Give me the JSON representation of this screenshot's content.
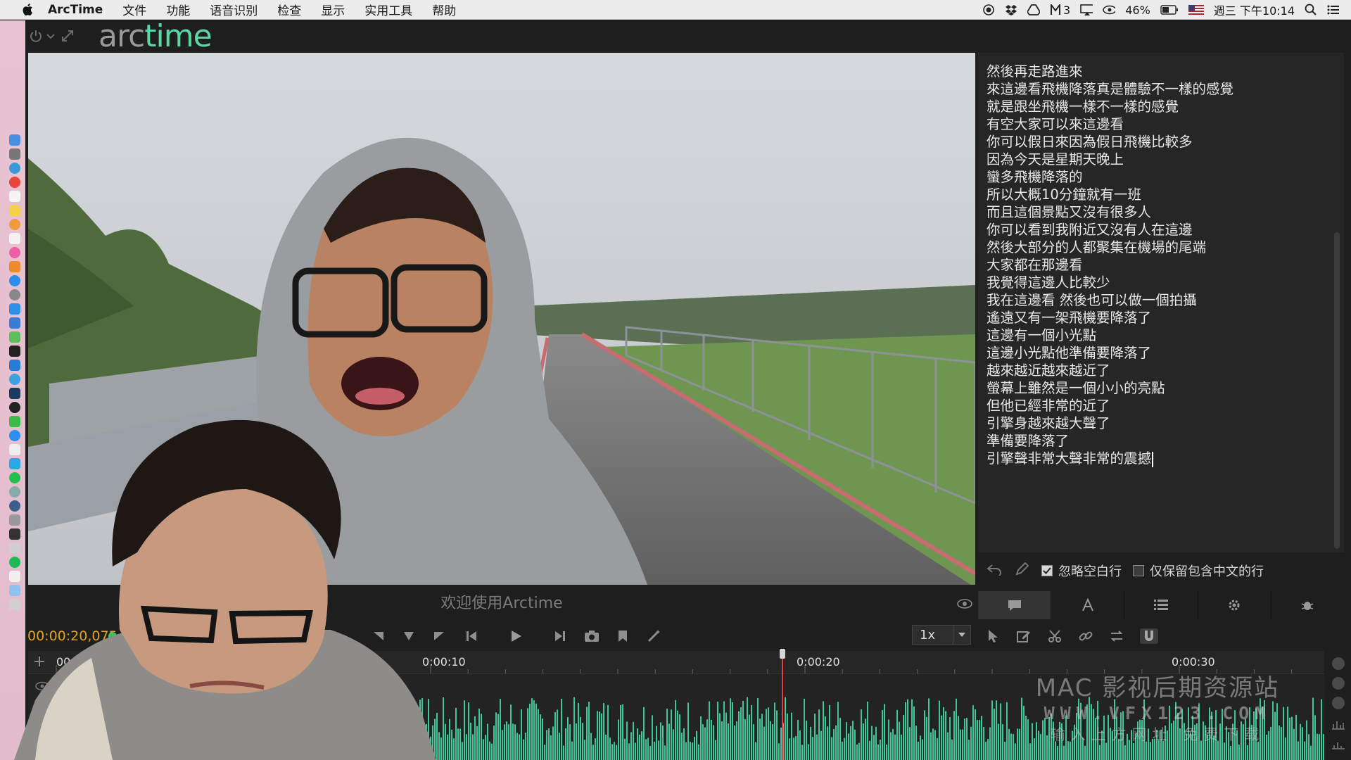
{
  "menubar": {
    "app_name": "ArcTime",
    "items": [
      "文件",
      "功能",
      "语音识别",
      "检查",
      "显示",
      "实用工具",
      "帮助"
    ],
    "status": {
      "notif_count": "3",
      "battery": "46%",
      "datetime": "週三 下午10:14"
    }
  },
  "app": {
    "logo_arc": "arc",
    "logo_time": "time",
    "preview_caption": "欢迎使用Arctime",
    "timecode": "00:00:20,075",
    "speed": "1x"
  },
  "subtitles": {
    "lines": [
      "然後再走路進來",
      "來這邊看飛機降落真是體驗不一樣的感覺",
      "就是跟坐飛機一樣不一樣的感覺",
      "有空大家可以來這邊看",
      "你可以假日來因為假日飛機比較多",
      "因為今天是星期天晚上",
      "蠻多飛機降落的",
      "所以大概10分鐘就有一班",
      "而且這個景點又沒有很多人",
      "你可以看到我附近又沒有人在這邊",
      "然後大部分的人都聚集在機場的尾端",
      "大家都在那邊看",
      "我覺得這邊人比較少",
      "我在這邊看 然後也可以做一個拍攝",
      "遙遠又有一架飛機要降落了",
      "這邊有一個小光點",
      "這邊小光點他準備要降落了",
      "越來越近越來越近了",
      "螢幕上雖然是一個小小的亮點",
      "但他已經非常的近了",
      "引擎身越來越大聲了",
      "準備要降落了",
      "引擎聲非常大聲非常的震撼"
    ],
    "ignore_blank_label": "忽略空白行",
    "ignore_blank_checked": true,
    "keep_chinese_label": "仅保留包含中文的行",
    "keep_chinese_checked": false
  },
  "timeline": {
    "labels": [
      "00:00",
      "0:00:10",
      "0:00:20",
      "0:00:30"
    ],
    "playhead_seconds": 20.075
  },
  "watermark": {
    "line1": "MAC 影视后期资源站",
    "line2": "WWW.VFX123.COM",
    "line3": "输入上方网址 免费下载"
  },
  "colors": {
    "accent_green": "#5dd6a5",
    "timecode": "#e3a41b",
    "playhead": "#e0413a",
    "waveform": "#3fc79a"
  }
}
